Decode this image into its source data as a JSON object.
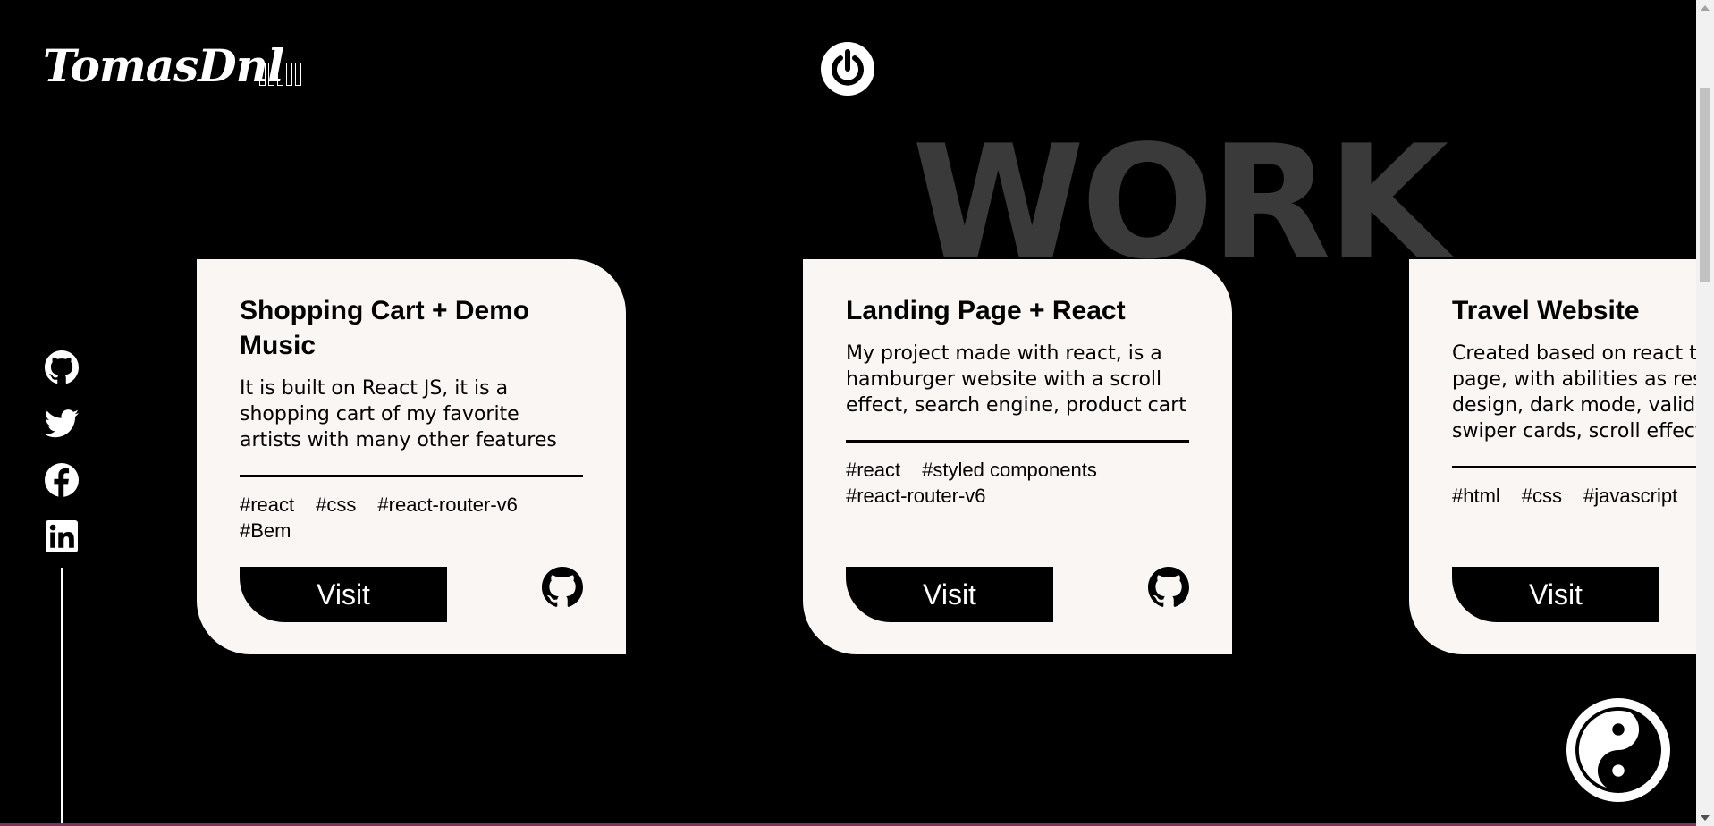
{
  "header": {
    "logo": "TomasDnl",
    "glyph_count": 5
  },
  "background_word": "WORK",
  "social": {
    "icons": [
      "github-icon",
      "twitter-icon",
      "facebook-icon",
      "linkedin-icon"
    ]
  },
  "projects": [
    {
      "title": "Shopping Cart + Demo Music",
      "description": "It is built on React JS, it is a shopping cart of my favorite artists with many other features",
      "tags": [
        "#react",
        "#css",
        "#react-router-v6",
        "#Bem"
      ],
      "visit_label": "Visit"
    },
    {
      "title": "Landing Page + React",
      "description": "My project made with react, is a hamburger website with a scroll effect, search engine, product cart",
      "tags": [
        "#react",
        "#styled components",
        "#react-router-v6"
      ],
      "visit_label": "Visit"
    },
    {
      "title": "Travel Website",
      "description": "Created based on react travel page, with abilities as responsive design, dark mode, validate form, swiper cards, scroll effect",
      "tags": [
        "#html",
        "#css",
        "#javascript"
      ],
      "visit_label": "Visit"
    }
  ],
  "colors": {
    "background": "#000000",
    "card": "#faf6f3",
    "watermark": "#3a3a3a"
  }
}
